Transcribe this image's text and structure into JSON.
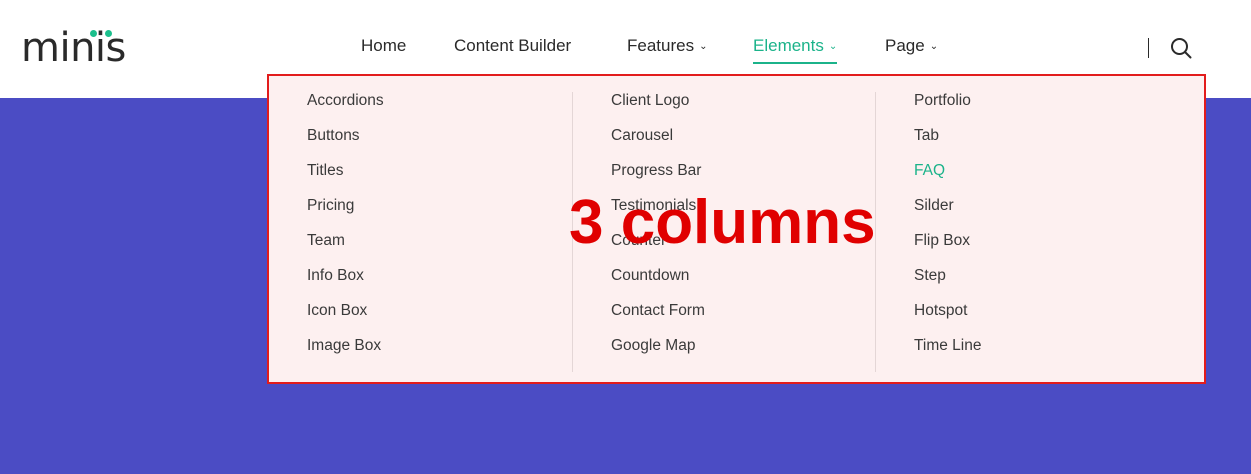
{
  "logo": {
    "text": "minis",
    "dot_color": "#1bbf8c"
  },
  "nav": {
    "items": [
      {
        "label": "Home",
        "has_dropdown": false
      },
      {
        "label": "Content Builder",
        "has_dropdown": false
      },
      {
        "label": "Features",
        "has_dropdown": true
      },
      {
        "label": "Elements",
        "has_dropdown": true,
        "active": true
      },
      {
        "label": "Page",
        "has_dropdown": true
      }
    ],
    "chevron": "⌄",
    "search_icon": "search-icon"
  },
  "mega_menu": {
    "columns": [
      {
        "items": [
          "Accordions",
          "Buttons",
          "Titles",
          "Pricing",
          "Team",
          "Info Box",
          "Icon Box",
          "Image Box"
        ]
      },
      {
        "items": [
          "Client Logo",
          "Carousel",
          "Progress Bar",
          "Testimonials",
          "Counter",
          "Countdown",
          "Contact Form",
          "Google Map"
        ]
      },
      {
        "items": [
          "Portfolio",
          "Tab",
          "FAQ",
          "Silder",
          "Flip Box",
          "Step",
          "Hotspot",
          "Time Line"
        ],
        "active_item": "FAQ"
      }
    ]
  },
  "annotation": {
    "text": "3 columns",
    "color": "#e00000"
  },
  "colors": {
    "accent": "#1bb38a",
    "background": "#4b4cc4",
    "menu_bg": "#fdf0f0",
    "menu_border": "#e21c1c"
  }
}
